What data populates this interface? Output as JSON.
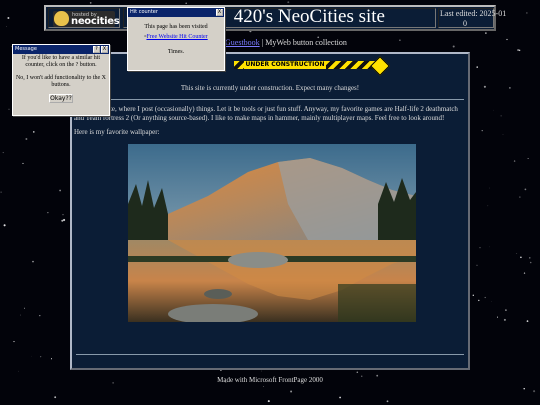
{
  "header": {
    "logo_small": "hosted by",
    "logo_text": "neocities",
    "site_title": "420's NeoCities site",
    "last_edited": "Last edited: 2025-01",
    "counter_value": "0"
  },
  "nav": {
    "link_text": "Guestbook",
    "separator": "|",
    "button_collection": "MyWeb button collection"
  },
  "main": {
    "banner_text": "UNDER CONSTRUCTION",
    "construction_message": "This site is currently under construction. Expect many changes!",
    "intro_text": "This is my site, where I post (occasionally) things. Let it be tools or just fun stuff. Anyway, my favorite games are Half-life 2 deathmatch and Team fortress 2 (Or anything source-based). I like to make maps in hammer, mainly multiplayer maps. Feel free to look around!",
    "wallpaper_label": "Here is my favorite wallpaper:"
  },
  "footer": {
    "text": "Made with Microsoft FrontPage 2000"
  },
  "message_popup": {
    "title": "Message",
    "line1": "If you'd like to have a similar hit counter, click on the ? button.",
    "line2": "No, I won't add functionality to the X buttons.",
    "ok_label": "Okay??",
    "help_btn": "?",
    "close_btn": "X"
  },
  "counter_popup": {
    "title": "Hit counter",
    "line1": "This page has been visited",
    "link": "Free Website Hit Counter",
    "line2": "Times.",
    "close_btn": "X"
  },
  "colors": {
    "panel": "#0b1d36",
    "titlebar": "#0a246a",
    "banner_yellow": "#ffe100"
  }
}
